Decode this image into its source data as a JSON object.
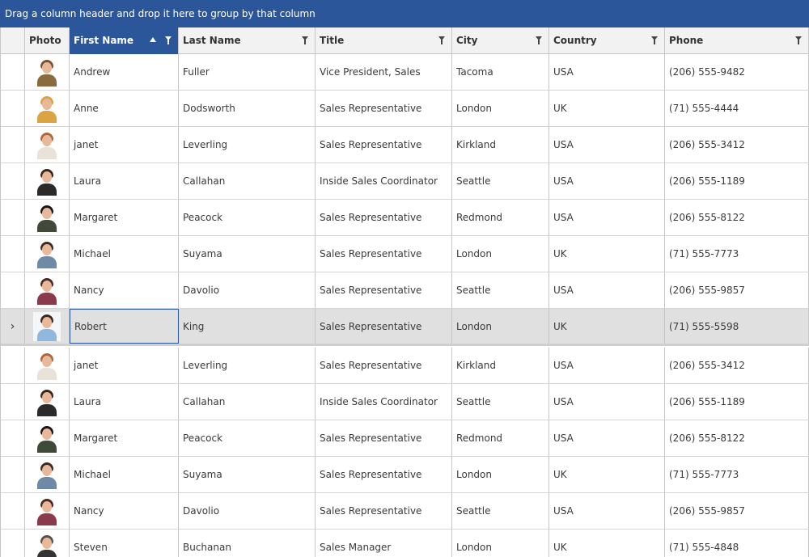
{
  "group_panel": {
    "text": "Drag a column header and drop it here to group by that column"
  },
  "colors": {
    "accent": "#2b579a",
    "selected_row": "#e0e0e0",
    "header_bg": "#f2f2f2"
  },
  "columns": [
    {
      "key": "photo",
      "label": "Photo",
      "filter": false,
      "sorted": false
    },
    {
      "key": "first",
      "label": "First Name",
      "filter": true,
      "sorted": true,
      "sort_dir": "ascending"
    },
    {
      "key": "last",
      "label": "Last Name",
      "filter": true,
      "sorted": false
    },
    {
      "key": "title",
      "label": "Title",
      "filter": true,
      "sorted": false
    },
    {
      "key": "city",
      "label": "City",
      "filter": true,
      "sorted": false
    },
    {
      "key": "country",
      "label": "Country",
      "filter": true,
      "sorted": false
    },
    {
      "key": "phone",
      "label": "Phone",
      "filter": true,
      "sorted": false
    }
  ],
  "rows": [
    {
      "first": "Andrew",
      "last": "Fuller",
      "title": "Vice President, Sales",
      "city": "Tacoma",
      "country": "USA",
      "phone": "(206) 555-9482",
      "hair": "#7a5230",
      "shirt": "#8a6a3e",
      "selected": false
    },
    {
      "first": "Anne",
      "last": "Dodsworth",
      "title": "Sales Representative",
      "city": "London",
      "country": "UK",
      "phone": "(71) 555-4444",
      "hair": "#d9a441",
      "shirt": "#d9a441",
      "selected": false
    },
    {
      "first": "janet",
      "last": "Leverling",
      "title": "Sales Representative",
      "city": "Kirkland",
      "country": "USA",
      "phone": "(206) 555-3412",
      "hair": "#b0653a",
      "shirt": "#e8e2d8",
      "selected": false
    },
    {
      "first": "Laura",
      "last": "Callahan",
      "title": "Inside Sales Coordinator",
      "city": "Seattle",
      "country": "USA",
      "phone": "(206) 555-1189",
      "hair": "#3b2418",
      "shirt": "#2a2a2a",
      "selected": false
    },
    {
      "first": "Margaret",
      "last": "Peacock",
      "title": "Sales Representative",
      "city": "Redmond",
      "country": "USA",
      "phone": "(206) 555-8122",
      "hair": "#1e1410",
      "shirt": "#3f4a38",
      "selected": false
    },
    {
      "first": "Michael",
      "last": "Suyama",
      "title": "Sales Representative",
      "city": "London",
      "country": "UK",
      "phone": "(71) 555-7773",
      "hair": "#3b2a20",
      "shirt": "#6f8aa6",
      "selected": false
    },
    {
      "first": "Nancy",
      "last": "Davolio",
      "title": "Sales Representative",
      "city": "Seattle",
      "country": "USA",
      "phone": "(206) 555-9857",
      "hair": "#4a2a1e",
      "shirt": "#8a3a4a",
      "selected": false
    },
    {
      "first": "Robert",
      "last": "King",
      "title": "Sales Representative",
      "city": "London",
      "country": "UK",
      "phone": "(71) 555-5598",
      "hair": "#3b2a20",
      "shirt": "#8fb8de",
      "selected": true
    },
    {
      "first": "janet",
      "last": "Leverling",
      "title": "Sales Representative",
      "city": "Kirkland",
      "country": "USA",
      "phone": "(206) 555-3412",
      "hair": "#b0653a",
      "shirt": "#e8e2d8",
      "selected": false
    },
    {
      "first": "Laura",
      "last": "Callahan",
      "title": "Inside Sales Coordinator",
      "city": "Seattle",
      "country": "USA",
      "phone": "(206) 555-1189",
      "hair": "#3b2418",
      "shirt": "#2a2a2a",
      "selected": false
    },
    {
      "first": "Margaret",
      "last": "Peacock",
      "title": "Sales Representative",
      "city": "Redmond",
      "country": "USA",
      "phone": "(206) 555-8122",
      "hair": "#1e1410",
      "shirt": "#3f4a38",
      "selected": false
    },
    {
      "first": "Michael",
      "last": "Suyama",
      "title": "Sales Representative",
      "city": "London",
      "country": "UK",
      "phone": "(71) 555-7773",
      "hair": "#3b2a20",
      "shirt": "#6f8aa6",
      "selected": false
    },
    {
      "first": "Nancy",
      "last": "Davolio",
      "title": "Sales Representative",
      "city": "Seattle",
      "country": "USA",
      "phone": "(206) 555-9857",
      "hair": "#4a2a1e",
      "shirt": "#8a3a4a",
      "selected": false
    },
    {
      "first": "Steven",
      "last": "Buchanan",
      "title": "Sales Manager",
      "city": "London",
      "country": "UK",
      "phone": "(71) 555-4848",
      "hair": "#5a5048",
      "shirt": "#333333",
      "selected": false
    }
  ]
}
